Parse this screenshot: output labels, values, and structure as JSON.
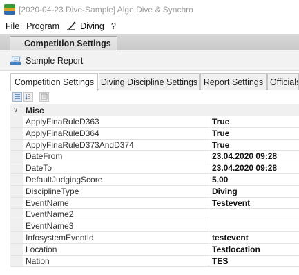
{
  "window": {
    "title": "[2020-04-23 Dive-Sample] Alge Dive & Synchro",
    "icon": "app-logo-icon"
  },
  "menu": [
    {
      "label": "File"
    },
    {
      "label": "Program"
    },
    {
      "label": "Diving",
      "icon": "diving-icon"
    },
    {
      "label": "?"
    }
  ],
  "document_tab": {
    "label": "Competition Settings"
  },
  "toolbar": {
    "sample_report_label": "Sample Report",
    "sample_report_icon": "report-icon"
  },
  "tabs": [
    {
      "label": "Competition Settings",
      "active": true
    },
    {
      "label": "Diving Discipline Settings",
      "active": false
    },
    {
      "label": "Report Settings",
      "active": false
    },
    {
      "label": "Officials",
      "active": false
    }
  ],
  "grid_toolbar": {
    "icons": [
      "categorized-sort-icon",
      "alphabetical-sort-icon",
      "property-pages-icon"
    ]
  },
  "category": {
    "name": "Misc",
    "expanded": true
  },
  "properties": [
    {
      "name": "ApplyFinaRuleD363",
      "value": "True"
    },
    {
      "name": "ApplyFinaRuleD364",
      "value": "True"
    },
    {
      "name": "ApplyFinaRuleD373AndD374",
      "value": "True"
    },
    {
      "name": "DateFrom",
      "value": "23.04.2020 09:28"
    },
    {
      "name": "DateTo",
      "value": "23.04.2020 09:28"
    },
    {
      "name": "DefaultJudgingScore",
      "value": "5,00"
    },
    {
      "name": "DisciplineType",
      "value": "Diving"
    },
    {
      "name": "EventName",
      "value": "Testevent"
    },
    {
      "name": "EventName2",
      "value": ""
    },
    {
      "name": "EventName3",
      "value": ""
    },
    {
      "name": "InfosystemEventId",
      "value": "testevent"
    },
    {
      "name": "Location",
      "value": "Testlocation"
    },
    {
      "name": "Nation",
      "value": "TES"
    }
  ],
  "colors": {
    "window_title": "#9a9a9a",
    "doc_strip": "#d0d0d0",
    "grid_gutter": "#f0f0f0",
    "grid_line": "#e3e3e3"
  }
}
